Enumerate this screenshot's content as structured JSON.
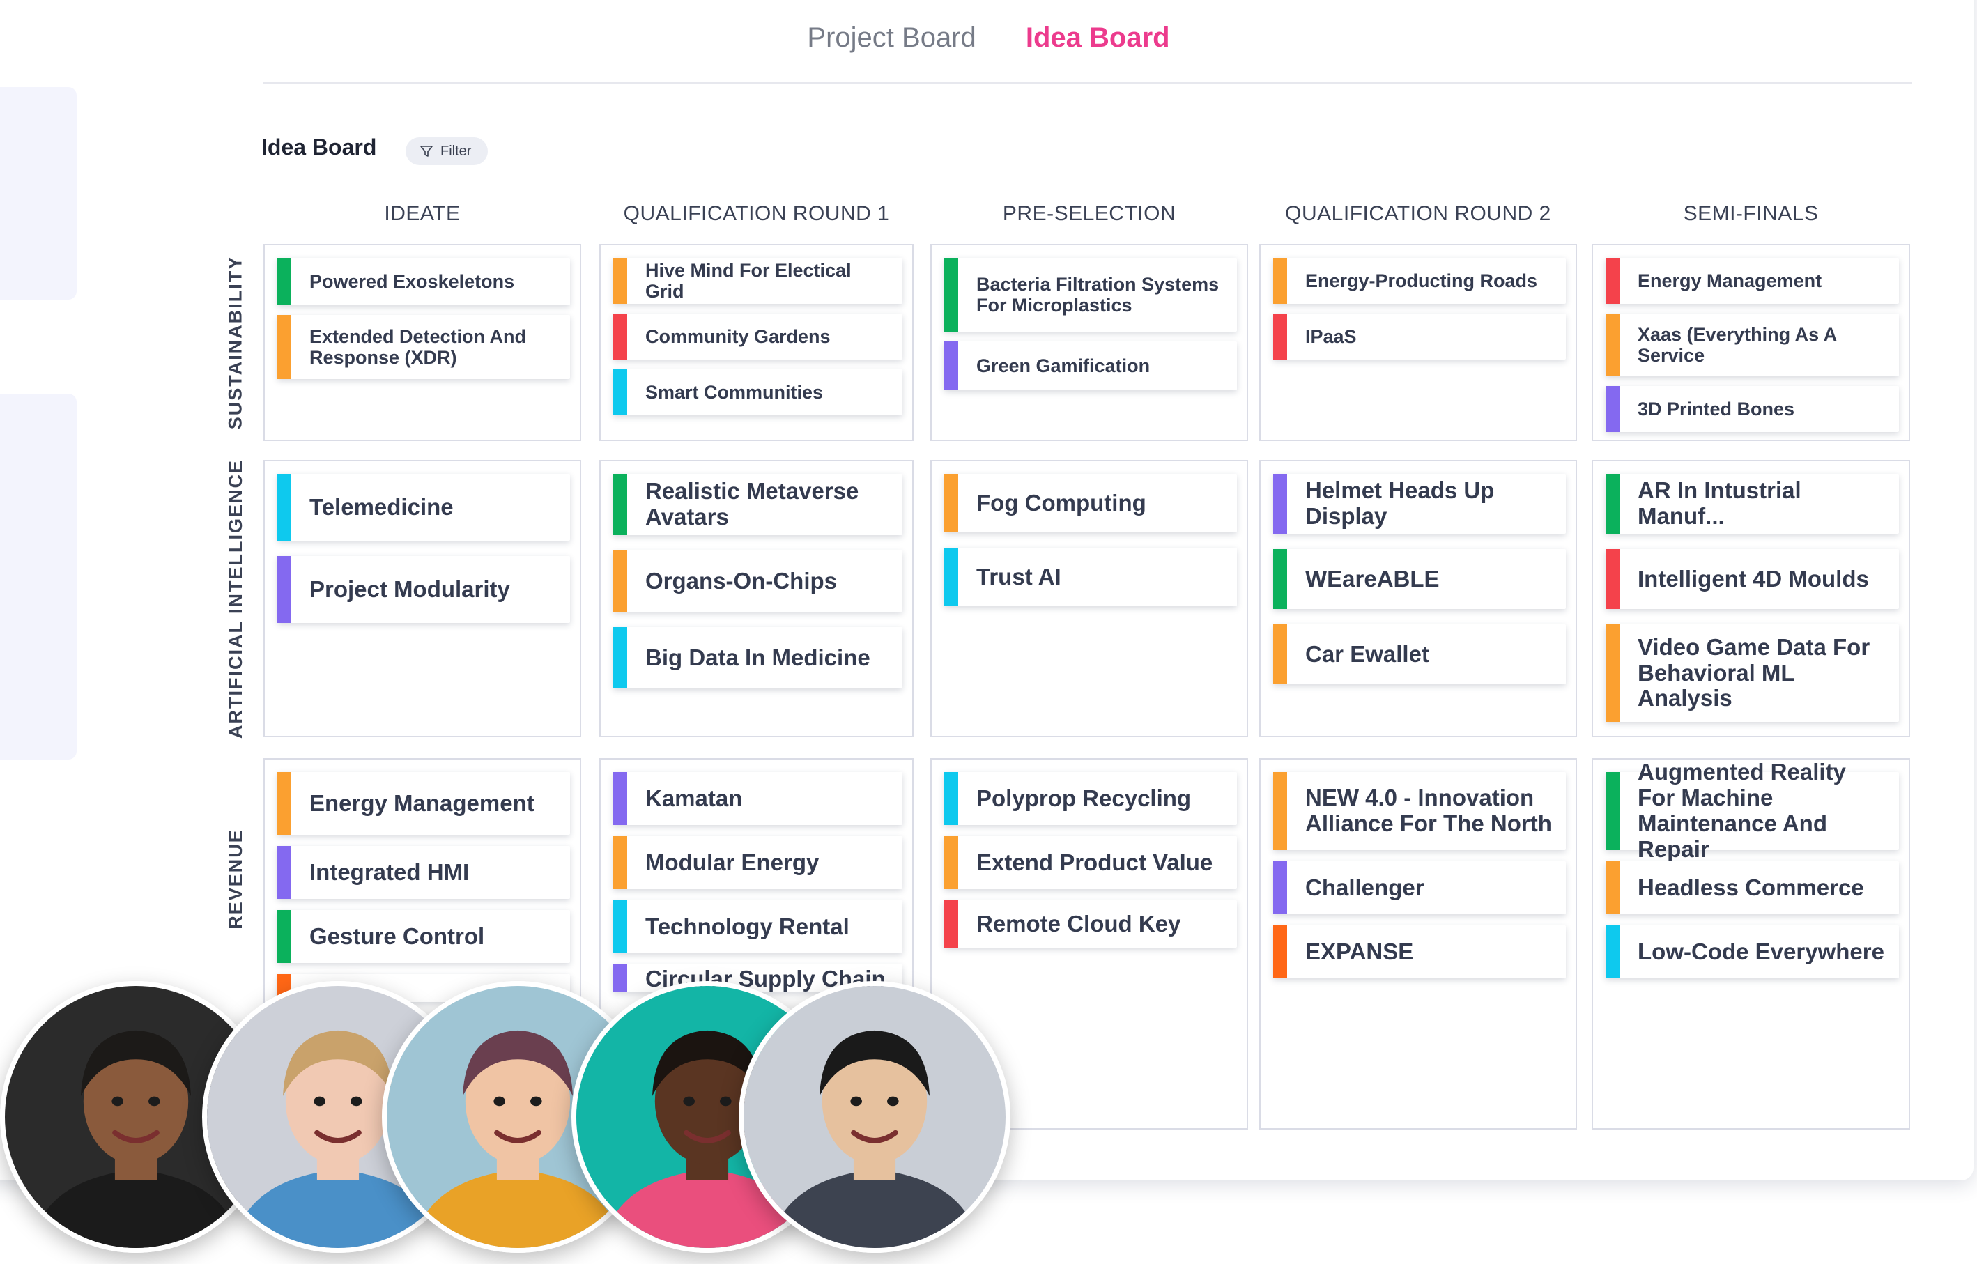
{
  "tabs": [
    {
      "label": "Project Board",
      "active": false
    },
    {
      "label": "Idea Board",
      "active": true
    }
  ],
  "board": {
    "title": "Idea Board",
    "filter_label": "Filter"
  },
  "colors": {
    "green": "#0bb15c",
    "orange": "#fba030",
    "red": "#f4424b",
    "cyan": "#0ec9ee",
    "purple": "#8469f0",
    "deep_orange": "#ff6716",
    "accent_pink": "#ec3b8d"
  },
  "columns": [
    "IDEATE",
    "QUALIFICATION ROUND 1",
    "PRE-SELECTION",
    "QUALIFICATION ROUND 2",
    "SEMI-FINALS"
  ],
  "rows": [
    {
      "label": "SUSTAINABILITY",
      "cells": [
        [
          {
            "title": "Powered Exoskeletons",
            "color": "green"
          },
          {
            "title": "Extended Detection And Response (XDR)",
            "color": "orange"
          }
        ],
        [
          {
            "title": "Hive Mind For Electical Grid",
            "color": "orange"
          },
          {
            "title": "Community Gardens",
            "color": "red"
          },
          {
            "title": "Smart Communities",
            "color": "cyan"
          }
        ],
        [
          {
            "title": "Bacteria Filtration Systems For Microplastics",
            "color": "green"
          },
          {
            "title": "Green Gamification",
            "color": "purple"
          }
        ],
        [
          {
            "title": "Energy-Producting Roads",
            "color": "orange"
          },
          {
            "title": "IPaaS",
            "color": "red"
          }
        ],
        [
          {
            "title": "Energy Management",
            "color": "red"
          },
          {
            "title": "Xaas (Everything As A Service",
            "color": "orange"
          },
          {
            "title": "3D Printed Bones",
            "color": "purple"
          }
        ]
      ]
    },
    {
      "label": "ARTIFICIAL INTELLIGENCE",
      "cells": [
        [
          {
            "title": "Telemedicine",
            "color": "cyan"
          },
          {
            "title": "Project Modularity",
            "color": "purple"
          }
        ],
        [
          {
            "title": "Realistic Metaverse Avatars",
            "color": "green"
          },
          {
            "title": "Organs-On-Chips",
            "color": "orange"
          },
          {
            "title": "Big Data In Medicine",
            "color": "cyan"
          }
        ],
        [
          {
            "title": "Fog Computing",
            "color": "orange"
          },
          {
            "title": "Trust AI",
            "color": "cyan"
          }
        ],
        [
          {
            "title": "Helmet Heads Up Display",
            "color": "purple"
          },
          {
            "title": "WEareABLE",
            "color": "green"
          },
          {
            "title": "Car Ewallet",
            "color": "orange"
          }
        ],
        [
          {
            "title": "AR In Intustrial Manuf...",
            "color": "green"
          },
          {
            "title": "Intelligent 4D Moulds",
            "color": "red"
          },
          {
            "title": "Video Game Data For Behavioral ML Analysis",
            "color": "orange"
          }
        ]
      ]
    },
    {
      "label": "REVENUE",
      "cells": [
        [
          {
            "title": "Energy Management",
            "color": "orange"
          },
          {
            "title": "Integrated HMI",
            "color": "purple"
          },
          {
            "title": "Gesture Control",
            "color": "green"
          },
          {
            "title": "",
            "color": "deep_orange"
          }
        ],
        [
          {
            "title": "Kamatan",
            "color": "purple"
          },
          {
            "title": "Modular Energy",
            "color": "orange"
          },
          {
            "title": "Technology Rental",
            "color": "cyan"
          },
          {
            "title": "Circular Supply Chain",
            "color": "purple"
          }
        ],
        [
          {
            "title": "Polyprop Recycling",
            "color": "cyan"
          },
          {
            "title": "Extend Product Value",
            "color": "orange"
          },
          {
            "title": "Remote Cloud Key",
            "color": "red"
          }
        ],
        [
          {
            "title": "NEW 4.0 - Innovation Alliance For The North",
            "color": "orange"
          },
          {
            "title": "Challenger",
            "color": "purple"
          },
          {
            "title": "EXPANSE",
            "color": "deep_orange"
          }
        ],
        [
          {
            "title": "Augmented Reality For Machine Maintenance And Repair",
            "color": "green"
          },
          {
            "title": "Headless Commerce",
            "color": "orange"
          },
          {
            "title": "Low-Code Everywhere",
            "color": "cyan"
          }
        ]
      ]
    }
  ],
  "avatars": [
    {
      "name": "avatar-man-glasses",
      "bg": "#2b2b2b",
      "skin": "#8a5a3c",
      "hair": "#1c1a18",
      "shirt": "#1b1b1b"
    },
    {
      "name": "avatar-woman-blonde",
      "bg": "#cdd0d8",
      "skin": "#f1c9b3",
      "hair": "#c9a26b",
      "shirt": "#4a90c8"
    },
    {
      "name": "avatar-man-beanie",
      "bg": "#9fc5d4",
      "skin": "#f0c4a4",
      "hair": "#6a3f4f",
      "shirt": "#e9a227"
    },
    {
      "name": "avatar-woman-braids",
      "bg": "#13b5a6",
      "skin": "#5a3522",
      "hair": "#1b1410",
      "shirt": "#ea4f7d"
    },
    {
      "name": "avatar-man-office",
      "bg": "#c9ced6",
      "skin": "#e6c19e",
      "hair": "#1a1a1a",
      "shirt": "#3d4350"
    }
  ]
}
